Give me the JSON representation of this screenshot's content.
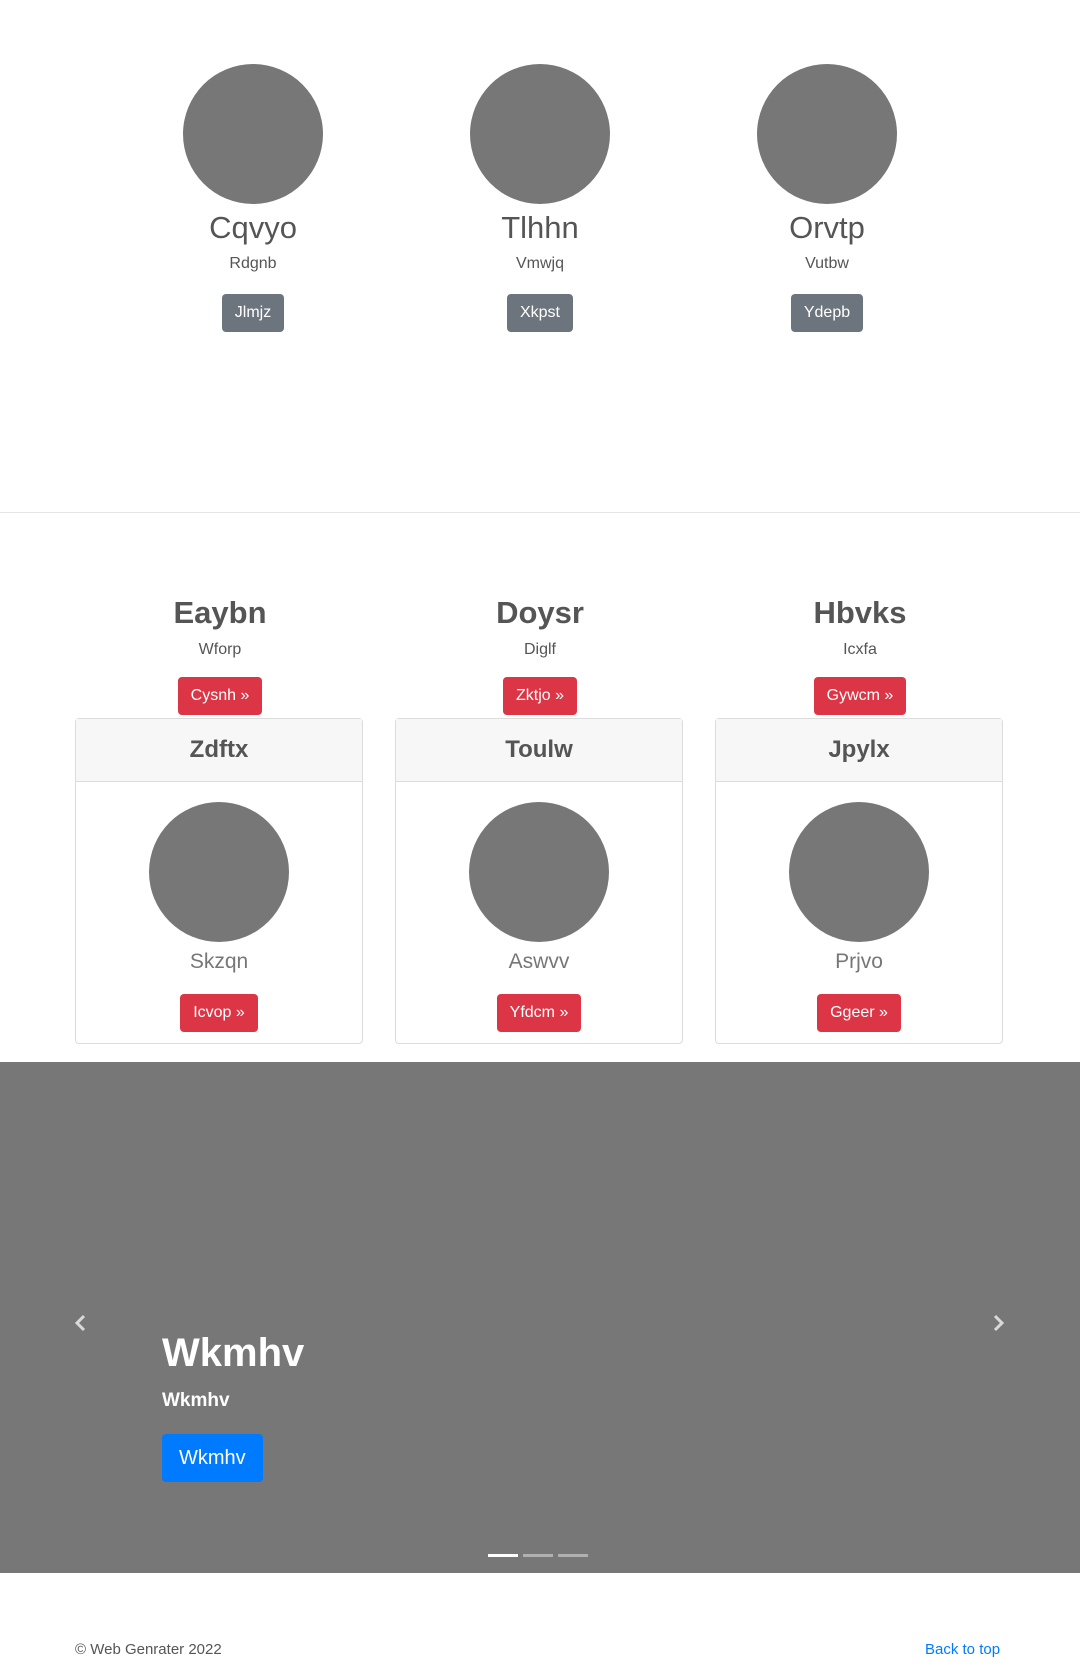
{
  "team": [
    {
      "name": "Cqvyo",
      "role": "Rdgnb",
      "button": "Jlmjz"
    },
    {
      "name": "Tlhhn",
      "role": "Vmwjq",
      "button": "Xkpst"
    },
    {
      "name": "Orvtp",
      "role": "Vutbw",
      "button": "Ydepb"
    }
  ],
  "features": [
    {
      "title": "Eaybn",
      "text": "Wforp",
      "button": "Cysnh »"
    },
    {
      "title": "Doysr",
      "text": "Diglf",
      "button": "Zktjo »"
    },
    {
      "title": "Hbvks",
      "text": "Icxfa",
      "button": "Gywcm »"
    }
  ],
  "cards": [
    {
      "header": "Zdftx",
      "text": "Skzqn",
      "button": "Icvop »"
    },
    {
      "header": "Toulw",
      "text": "Aswvv",
      "button": "Yfdcm »"
    },
    {
      "header": "Jpylx",
      "text": "Prjvo",
      "button": "Ggeer »"
    }
  ],
  "carousel": {
    "title": "Wkmhv",
    "subtitle": "Wkmhv",
    "button": "Wkmhv",
    "prev_icon": "chevron-left-icon",
    "next_icon": "chevron-right-icon",
    "slides": 3,
    "active_slide": 1
  },
  "footer": {
    "copyright": "© Web Genrater 2022",
    "back_to_top": "Back to top"
  },
  "colors": {
    "placeholder": "#777777",
    "secondary_button": "#6c757d",
    "danger_button": "#dc3545",
    "primary_button": "#007bff",
    "link": "#007bff"
  }
}
